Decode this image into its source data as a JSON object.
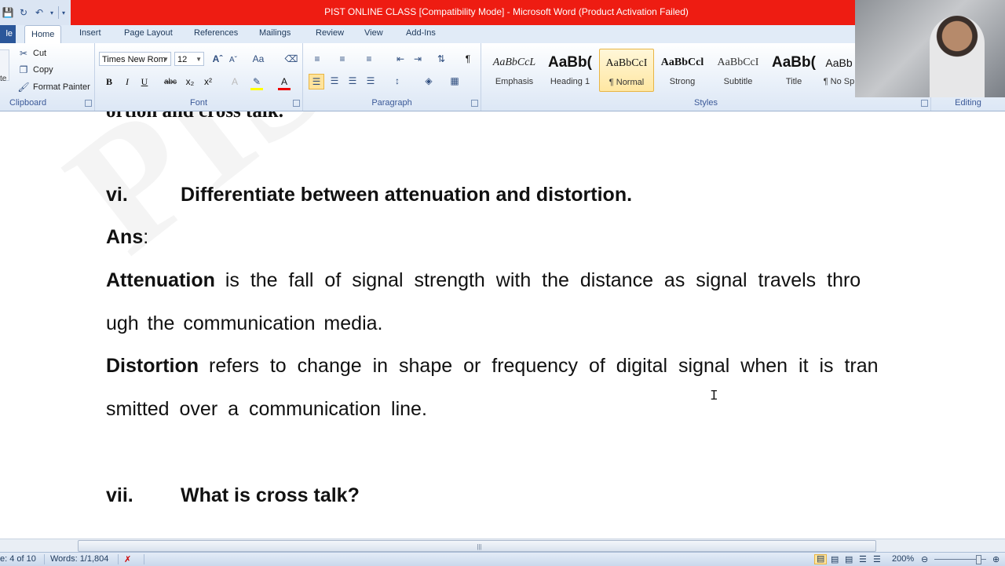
{
  "window": {
    "title": "PIST ONLINE CLASS [Compatibility Mode]  -  Microsoft Word (Product Activation Failed)"
  },
  "ribbon": {
    "tabs": [
      "le",
      "Home",
      "Insert",
      "Page Layout",
      "References",
      "Mailings",
      "Review",
      "View",
      "Add-Ins"
    ],
    "active_tab": "Home",
    "clipboard": {
      "cut": "Cut",
      "copy": "Copy",
      "format_painter": "Format Painter",
      "label": "Clipboard",
      "paste_partial": "te"
    },
    "font": {
      "name": "Times New Rom",
      "size": "12",
      "label": "Font"
    },
    "paragraph": {
      "label": "Paragraph"
    },
    "styles": {
      "label": "Styles",
      "items": [
        {
          "preview": "AaBbCcL",
          "name": "Emphasis"
        },
        {
          "preview": "AaBb(",
          "name": "Heading 1"
        },
        {
          "preview": "AaBbCcI",
          "name": "¶ Normal"
        },
        {
          "preview": "AaBbCcl",
          "name": "Strong"
        },
        {
          "preview": "AaBbCcI",
          "name": "Subtitle"
        },
        {
          "preview": "AaBb(",
          "name": "Title"
        },
        {
          "preview": "AaBb",
          "name": "¶ No Sp"
        }
      ]
    },
    "editing": {
      "label": "Editing"
    }
  },
  "document": {
    "top_partial": "ortion and cross  talk.",
    "q6": {
      "num": "vi.",
      "text": "Differentiate between attenuation and distortion."
    },
    "ans_label": "Ans",
    "ans_colon": ":",
    "attenuation": {
      "term": "Attenuation",
      "line1": "is the fall of signal strength with the distance as signal travels thro",
      "line2": "ugh  the communication  media."
    },
    "distortion": {
      "term": "Distortion",
      "line1": "refers to change in shape or frequency of digital signal when it is tran",
      "line2": "smitted over a communication line."
    },
    "q7": {
      "num": "vii.",
      "text": "What is cross talk?"
    }
  },
  "status": {
    "page": "e: 4 of 10",
    "words": "Words: 1/1,804",
    "zoom": "200%"
  }
}
